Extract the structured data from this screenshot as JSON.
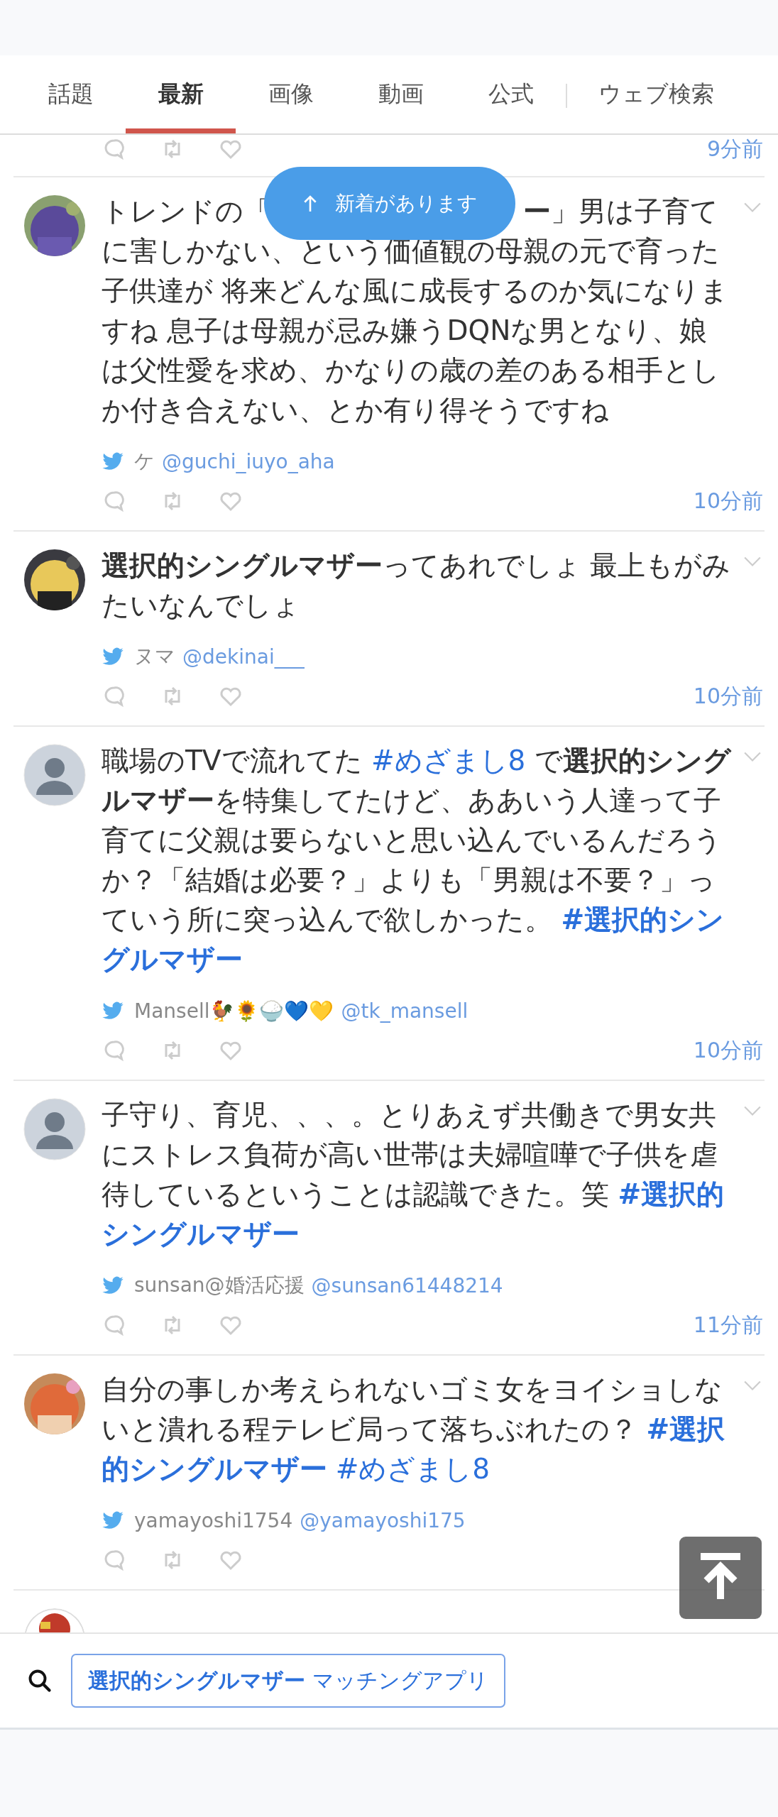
{
  "tabs": [
    {
      "label": "話題",
      "selected": false,
      "separated": false
    },
    {
      "label": "最新",
      "selected": true,
      "separated": false
    },
    {
      "label": "画像",
      "selected": false,
      "separated": false
    },
    {
      "label": "動画",
      "selected": false,
      "separated": false
    },
    {
      "label": "公式",
      "selected": false,
      "separated": false
    },
    {
      "label": "ウェブ検索",
      "selected": false,
      "separated": true
    }
  ],
  "new_posts_button": {
    "label": "新着があります"
  },
  "previous_post": {
    "time": "9分前"
  },
  "posts": [
    {
      "avatar": {
        "kind": "picture"
      },
      "lead": [
        {
          "kind": "text",
          "text": "トレンドの「"
        },
        {
          "kind": "gap"
        },
        {
          "kind": "bold",
          "text": "ー"
        },
        {
          "kind": "text",
          "text": "」男は子育て"
        }
      ],
      "segments": [
        {
          "kind": "text",
          "text": "に害しかない、という価値観の母親の元で育った子供達が 将来どんな風に成長するのか気になりますね 息子は母親が忌み嫌うDQNな男となり、娘は父性愛を求め、かなりの歳の差のある相手としか付き合えない、とか有り得そうですね"
        }
      ],
      "name": "ケ",
      "handle": "@guchi_iuyo_aha",
      "time": "10分前"
    },
    {
      "avatar": {
        "kind": "picture"
      },
      "segments": [
        {
          "kind": "bold",
          "text": "選択的シングルマザー"
        },
        {
          "kind": "text",
          "text": "ってあれでしょ 最上もがみたいなんでしょ"
        }
      ],
      "name": "ヌマ",
      "handle": "@dekinai___",
      "time": "10分前"
    },
    {
      "avatar": {
        "kind": "default"
      },
      "segments": [
        {
          "kind": "text",
          "text": "職場のTVで流れてた "
        },
        {
          "kind": "tag",
          "text": "#めざまし8"
        },
        {
          "kind": "text",
          "text": " で"
        },
        {
          "kind": "bold",
          "text": "選択的シングルマザー"
        },
        {
          "kind": "text",
          "text": "を特集してたけど、ああいう人達って子育てに父親は要らないと思い込んでいるんだろうか？「結婚は必要？」よりも「男親は不要？」っていう所に突っ込んで欲しかった。 "
        },
        {
          "kind": "bold_tag",
          "text": "#選択的シングルマザー"
        }
      ],
      "name": "Mansell🐓🌻🍚💙💛",
      "handle": "@tk_mansell",
      "time": "10分前"
    },
    {
      "avatar": {
        "kind": "default"
      },
      "segments": [
        {
          "kind": "text",
          "text": "子守り、育児、、、。とりあえず共働きで男女共にストレス負荷が高い世帯は夫婦喧嘩で子供を虐待しているということは認識できた。笑 "
        },
        {
          "kind": "bold_tag",
          "text": "#選択的シングルマザー"
        }
      ],
      "name": "sunsan@婚活応援",
      "handle": "@sunsan61448214",
      "time": "11分前"
    },
    {
      "avatar": {
        "kind": "picture"
      },
      "segments": [
        {
          "kind": "text",
          "text": "自分の事しか考えられないゴミ女をヨイショしないと潰れる程テレビ局って落ちぶれたの？ "
        },
        {
          "kind": "bold_tag",
          "text": "#選択的シングルマザー"
        },
        {
          "kind": "tag",
          "text": "#めざまし8"
        }
      ],
      "name": "yamayoshi1754",
      "handle": "@yamayoshi175"
    }
  ],
  "next_post": {
    "avatar": {
      "kind": "picture"
    }
  },
  "related_search": {
    "query": "**選択的シングルマザー** マッチングアプリ"
  }
}
